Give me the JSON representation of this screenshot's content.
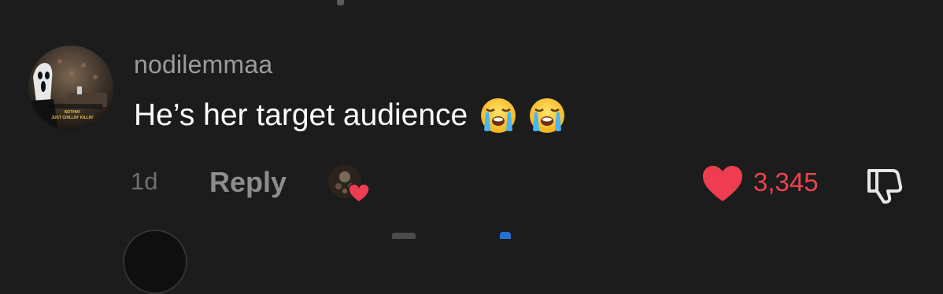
{
  "comment": {
    "username": "nodilemmaa",
    "text": "He’s her target audience",
    "emojis": [
      "loudly-crying-face-emoji",
      "loudly-crying-face-emoji"
    ],
    "timestamp": "1d",
    "reply_label": "Reply",
    "like_count": "3,345",
    "liked_by_creator": true,
    "avatar_caption": "NOTHIN' JUST CHILLIN' KILLIN'"
  },
  "icons": {
    "like": "heart-icon",
    "dislike": "thumbs-down-icon",
    "creator_liked": "creator-liked-heart-icon"
  },
  "colors": {
    "background": "#1c1c1c",
    "username": "#9b9b9b",
    "text": "#ffffff",
    "muted": "#6f6f6f",
    "like": "#e9444f"
  }
}
